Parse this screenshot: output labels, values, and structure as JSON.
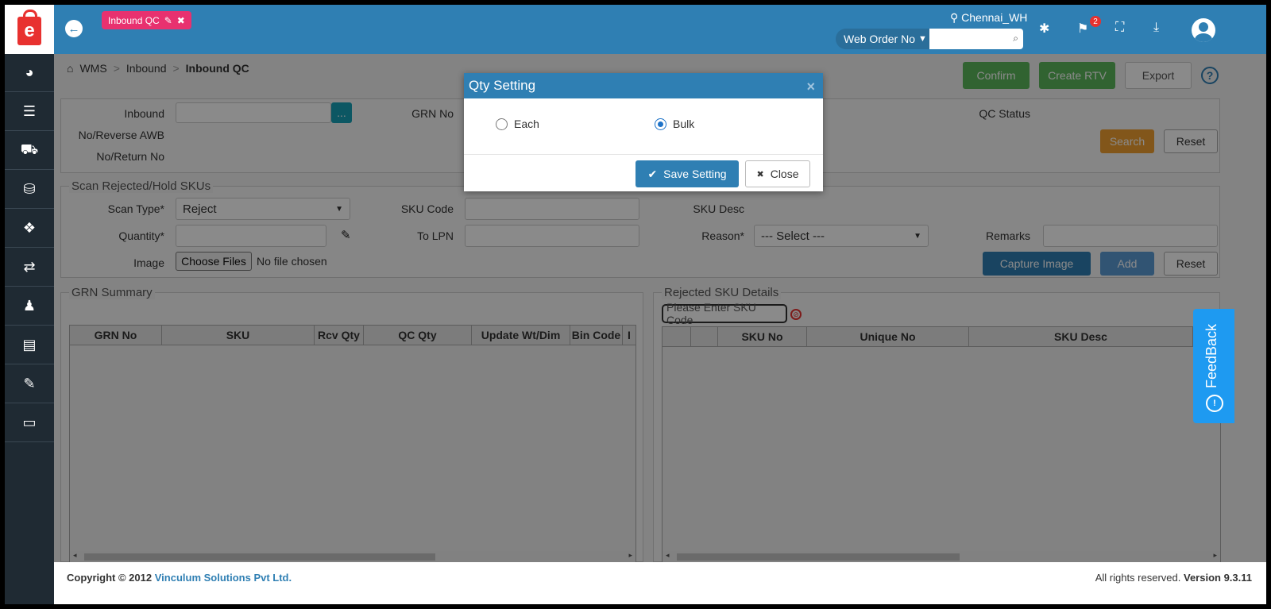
{
  "header": {
    "tab_label": "Inbound QC",
    "location": "Chennai_WH",
    "search_type": "Web Order No",
    "search_placeholder": "",
    "notification_count": "2"
  },
  "sidebar": {
    "items": [
      {
        "icon": "dashboard-icon",
        "glyph": "◕"
      },
      {
        "icon": "list-indent-icon",
        "glyph": "☰"
      },
      {
        "icon": "cart-icon",
        "glyph": "⛟"
      },
      {
        "icon": "bag-icon",
        "glyph": "⛁"
      },
      {
        "icon": "cubes-icon",
        "glyph": "❖"
      },
      {
        "icon": "exchange-icon",
        "glyph": "⇄"
      },
      {
        "icon": "user-plus-icon",
        "glyph": "♟"
      },
      {
        "icon": "book-icon",
        "glyph": "▤"
      },
      {
        "icon": "ticket-icon",
        "glyph": "✎"
      },
      {
        "icon": "card-icon",
        "glyph": "▭"
      }
    ]
  },
  "breadcrumb": {
    "home": "WMS",
    "level1": "Inbound",
    "current": "Inbound QC"
  },
  "toolbar": {
    "confirm": "Confirm",
    "create_rtv": "Create RTV",
    "export": "Export",
    "help": "?"
  },
  "filters": {
    "inbound_label": "Inbound",
    "reverse_awb_label": "No/Reverse AWB",
    "return_no_label": "No/Return No",
    "grn_no_label": "GRN No",
    "qc_status_label": "QC Status",
    "lookup": "...",
    "search": "Search",
    "reset": "Reset"
  },
  "scan": {
    "legend": "Scan Rejected/Hold SKUs",
    "scan_type_label": "Scan Type*",
    "scan_type_value": "Reject",
    "sku_code_label": "SKU Code",
    "sku_desc_label": "SKU Desc",
    "quantity_label": "Quantity*",
    "to_lpn_label": "To LPN",
    "reason_label": "Reason*",
    "reason_value": "--- Select ---",
    "remarks_label": "Remarks",
    "image_label": "Image",
    "choose_files": "Choose Files",
    "no_file": "No file chosen",
    "capture": "Capture Image",
    "add": "Add",
    "reset": "Reset"
  },
  "grn_summary": {
    "legend": "GRN Summary",
    "columns": [
      "GRN No",
      "SKU",
      "Rcv Qty",
      "QC Qty",
      "Update Wt/Dim",
      "Bin Code",
      "I"
    ]
  },
  "rejected": {
    "legend": "Rejected SKU Details",
    "sku_placeholder": "Please Enter SKU Code",
    "columns": [
      "",
      "",
      "SKU No",
      "Unique No",
      "SKU Desc"
    ]
  },
  "footer": {
    "copyright": "Copyright © 2012",
    "company": "Vinculum Solutions Pvt Ltd.",
    "rights": "All rights reserved.",
    "version": "Version 9.3.11"
  },
  "feedback": {
    "label": "FeedBack"
  },
  "modal": {
    "title": "Qty Setting",
    "option_each": "Each",
    "option_bulk": "Bulk",
    "selected": "Bulk",
    "save": "Save Setting",
    "close": "Close"
  }
}
